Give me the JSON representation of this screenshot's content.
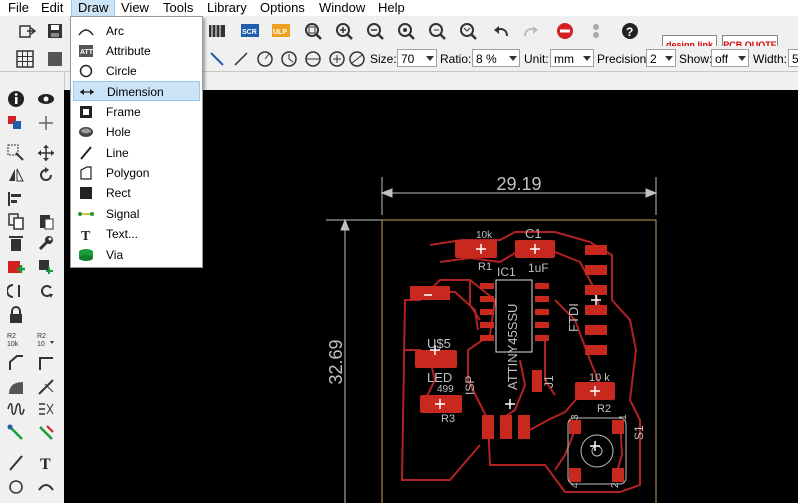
{
  "menu": [
    "File",
    "Edit",
    "Draw",
    "View",
    "Tools",
    "Library",
    "Options",
    "Window",
    "Help"
  ],
  "active_menu": "Draw",
  "draw_menu": [
    {
      "label": "Arc",
      "icon": "arc-icon"
    },
    {
      "label": "Attribute",
      "icon": "attribute-icon"
    },
    {
      "label": "Circle",
      "icon": "circle-icon"
    },
    {
      "label": "Dimension",
      "icon": "dimension-icon",
      "highlighted": true
    },
    {
      "label": "Frame",
      "icon": "frame-icon"
    },
    {
      "label": "Hole",
      "icon": "hole-icon"
    },
    {
      "label": "Line",
      "icon": "line-icon"
    },
    {
      "label": "Polygon",
      "icon": "polygon-icon"
    },
    {
      "label": "Rect",
      "icon": "rect-icon"
    },
    {
      "label": "Signal",
      "icon": "signal-icon"
    },
    {
      "label": "Text...",
      "icon": "text-icon"
    },
    {
      "label": "Via",
      "icon": "via-icon"
    }
  ],
  "toolbar": {
    "scr_label": "SCR",
    "ulp_label": "ULP",
    "design_link": "design link",
    "pcb_quote": "PCB QUOTE"
  },
  "params": {
    "size_label": "Size:",
    "size_value": "70",
    "ratio_label": "Ratio:",
    "ratio_value": "8 %",
    "unit_label": "Unit:",
    "unit_value": "mm",
    "precision_label": "Precision:",
    "precision_value": "2",
    "show_label": "Show:",
    "show_value": "off",
    "width_label": "Width:",
    "width_value": "5"
  },
  "pcb": {
    "dim_horizontal": "29.19",
    "dim_vertical": "32.69",
    "labels": {
      "r1_value": "10k",
      "r1_name": "R1",
      "c1_name": "C1",
      "c1_value": "1uF",
      "ic1_name": "IC1",
      "ic1_part": "ATTINY45SSU",
      "ftdi": "FTDI",
      "usb_name": "U$5",
      "led_name": "LED",
      "led_value": "499",
      "r3_name": "R3",
      "isp": "ISP",
      "j1": "J1",
      "r2_value": "10 k",
      "r2_name": "R2",
      "s1_name": "S1",
      "sw_pin1": "1",
      "sw_pin2": "2",
      "sw_pin3": "3",
      "sw_pin4": "4"
    },
    "colors": {
      "trace": "#b22222",
      "pad": "#c8281e",
      "dim": "#c0c0c0",
      "board_outline": "#c8a060"
    }
  }
}
